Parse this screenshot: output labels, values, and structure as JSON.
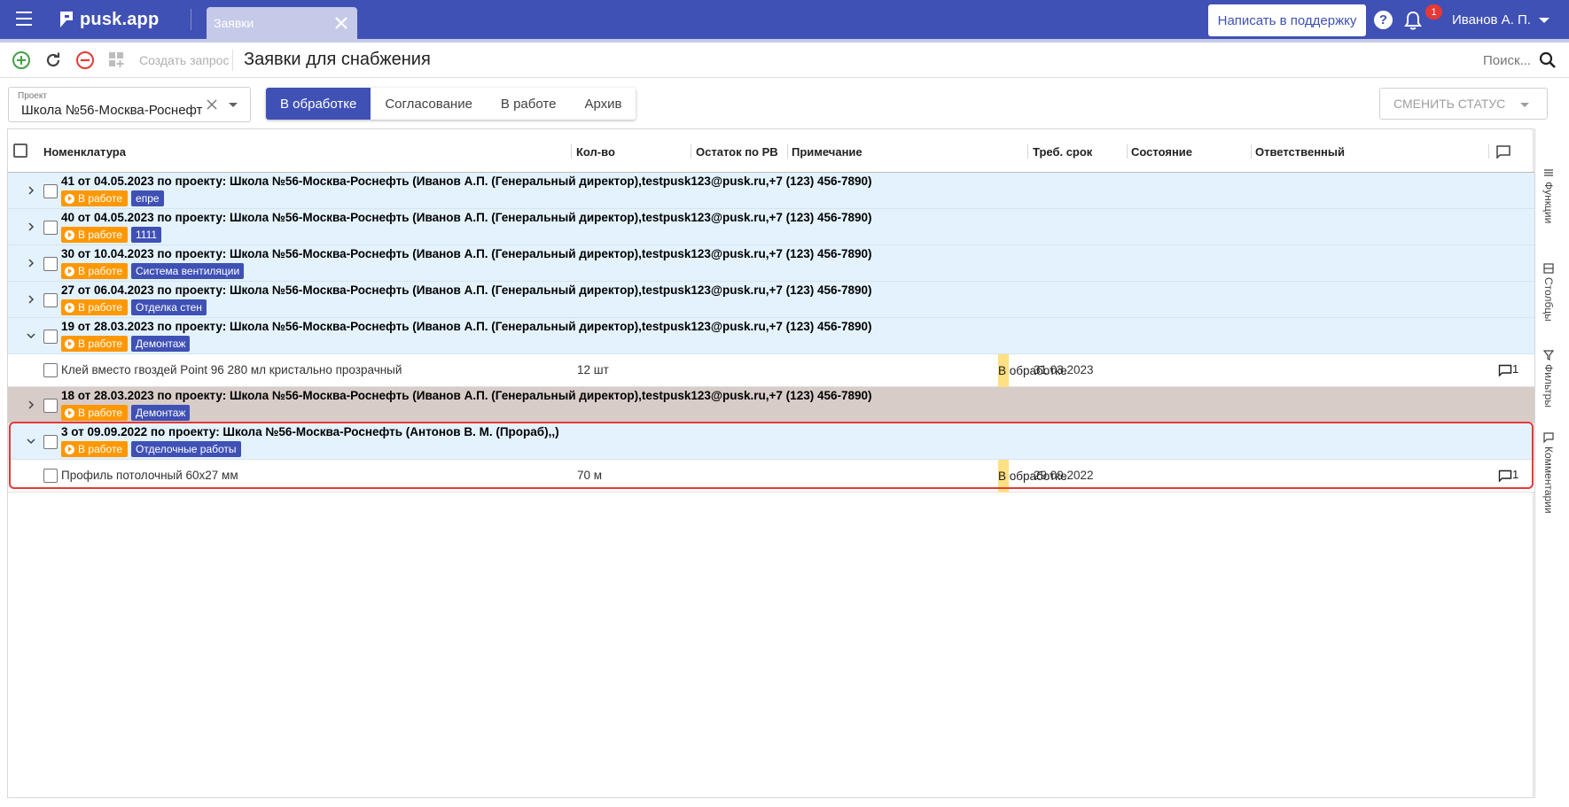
{
  "topbar": {
    "logo_text": "pusk.app",
    "tab_label": "Заявки",
    "support_button": "Написать в поддержку",
    "help_glyph": "?",
    "notifications_count": "1",
    "user_name": "Иванов А. П."
  },
  "toolbar": {
    "create_label": "Создать запрос",
    "page_title": "Заявки для снабжения",
    "search_label": "Поиск..."
  },
  "filters": {
    "project_label": "Проект",
    "project_value": "Школа №56-Москва-Роснефт",
    "status_tabs": [
      "В обработке",
      "Согласование",
      "В работе",
      "Архив"
    ],
    "active_tab": "В обработке",
    "change_status_label": "СМЕНИТЬ СТАТУС"
  },
  "grid": {
    "columns": {
      "name": "Номенклатура",
      "qty": "Кол-во",
      "remainder": "Остаток по РВ",
      "note": "Примечание",
      "deadline": "Треб. срок",
      "state": "Состояние",
      "responsible": "Ответственный"
    },
    "groups": [
      {
        "title": "41 от 04.05.2023 по проекту: Школа №56-Москва-Роснефть (Иванов А.П. (Генеральный директор),testpusk123@pusk.ru,+7 (123) 456-7890)",
        "status": "В работе",
        "tag": "епре"
      },
      {
        "title": "40 от 04.05.2023 по проекту: Школа №56-Москва-Роснефть (Иванов А.П. (Генеральный директор),testpusk123@pusk.ru,+7 (123) 456-7890)",
        "status": "В работе",
        "tag": "1111"
      },
      {
        "title": "30 от 10.04.2023 по проекту: Школа №56-Москва-Роснефть (Иванов А.П. (Генеральный директор),testpusk123@pusk.ru,+7 (123) 456-7890)",
        "status": "В работе",
        "tag": "Система вентиляции"
      },
      {
        "title": "27 от 06.04.2023 по проекту: Школа №56-Москва-Роснефть (Иванов А.П. (Генеральный директор),testpusk123@pusk.ru,+7 (123) 456-7890)",
        "status": "В работе",
        "tag": "Отделка стен"
      },
      {
        "title": "19 от 28.03.2023 по проекту: Школа №56-Москва-Роснефть (Иванов А.П. (Генеральный директор),testpusk123@pusk.ru,+7 (123) 456-7890)",
        "status": "В работе",
        "tag": "Демонтаж"
      },
      {
        "title": "18 от 28.03.2023 по проекту: Школа №56-Москва-Роснефть (Иванов А.П. (Генеральный директор),testpusk123@pusk.ru,+7 (123) 456-7890)",
        "status": "В работе",
        "tag": "Демонтаж"
      },
      {
        "title": "3 от 09.09.2022 по проекту: Школа №56-Москва-Роснефть (Антонов В. М. (Прораб),,)",
        "status": "В работе",
        "tag": "Отделочные работы"
      }
    ],
    "items": [
      {
        "name": "Клей вместо гвоздей Point 96 280 мл кристально прозрачный",
        "qty": "12 шт",
        "deadline": "31.03.2023",
        "state": "В обработке",
        "comments": "1"
      },
      {
        "name": "Профиль потолочный 60х27 мм",
        "qty": "70 м",
        "deadline": "29.09.2022",
        "state": "В обработке",
        "comments": "1"
      }
    ]
  },
  "side_panel": {
    "functions": "Функции",
    "columns": "Столбцы",
    "filters": "Фильтры",
    "comments": "Комментарии"
  },
  "colors": {
    "primary": "#3f51b5",
    "status_orange": "#ff9800",
    "group_bg": "#e3f2fd",
    "selected_group_bg": "#d7ccc8",
    "state_marker": "#ffe082",
    "highlight": "#e53935"
  }
}
